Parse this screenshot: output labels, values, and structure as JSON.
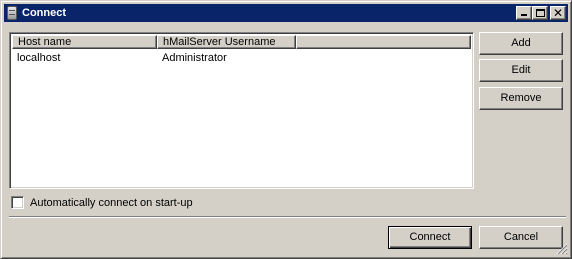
{
  "window": {
    "title": "Connect"
  },
  "titlebar": {
    "icons": [
      "app-icon",
      "minimize-icon",
      "maximize-icon",
      "close-icon"
    ],
    "close_glyph": "✕"
  },
  "list": {
    "columns": [
      "Host name",
      "hMailServer Username",
      ""
    ],
    "rows": [
      {
        "host": "localhost",
        "username": "Administrator"
      }
    ]
  },
  "buttons": {
    "add": "Add",
    "edit": "Edit",
    "remove": "Remove",
    "connect": "Connect",
    "cancel": "Cancel"
  },
  "options": {
    "auto_connect_label": "Automatically connect on start-up",
    "auto_connect_checked": false
  },
  "colors": {
    "titlebar": "#0a246a",
    "face": "#d4d0c8"
  }
}
